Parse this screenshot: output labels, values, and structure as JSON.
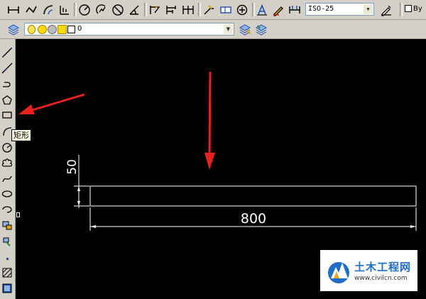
{
  "dimension_toolbar": {
    "dimstyle_value": "ISO-25",
    "bylayer_text": "By"
  },
  "layer_toolbar": {
    "current_layer": "0"
  },
  "tooltip": {
    "text": "矩形"
  },
  "drawing": {
    "vertical_dimension": "50",
    "horizontal_dimension": "800",
    "entity_color": "#ffffff",
    "background_color": "#000000",
    "arrow_color": "#e8201e"
  },
  "watermark": {
    "brand": "土木工程网",
    "url": "www.civilcn.com"
  },
  "icons": {
    "dimension": [
      "linear-dim-icon",
      "aligned-dim-icon",
      "arc-length-dim-icon",
      "ordinate-dim-icon",
      "radius-dim-icon",
      "jogged-dim-icon",
      "diameter-dim-icon",
      "angular-dim-icon",
      "quick-dim-icon",
      "baseline-dim-icon",
      "continue-dim-icon",
      "quick-leader-icon",
      "tolerance-icon",
      "center-mark-icon",
      "dimedit-icon",
      "dimtedit-icon",
      "dimstyle-update-icon",
      "dimstyle-manager-icon"
    ],
    "draw": [
      "line-icon",
      "construction-line-icon",
      "polyline-icon",
      "polygon-icon",
      "rectangle-icon",
      "arc-icon",
      "circle-icon",
      "revcloud-icon",
      "spline-icon",
      "ellipse-icon",
      "ellipse-arc-icon",
      "insert-block-icon",
      "make-block-icon",
      "point-icon",
      "hatch-icon",
      "gradient-icon"
    ]
  }
}
